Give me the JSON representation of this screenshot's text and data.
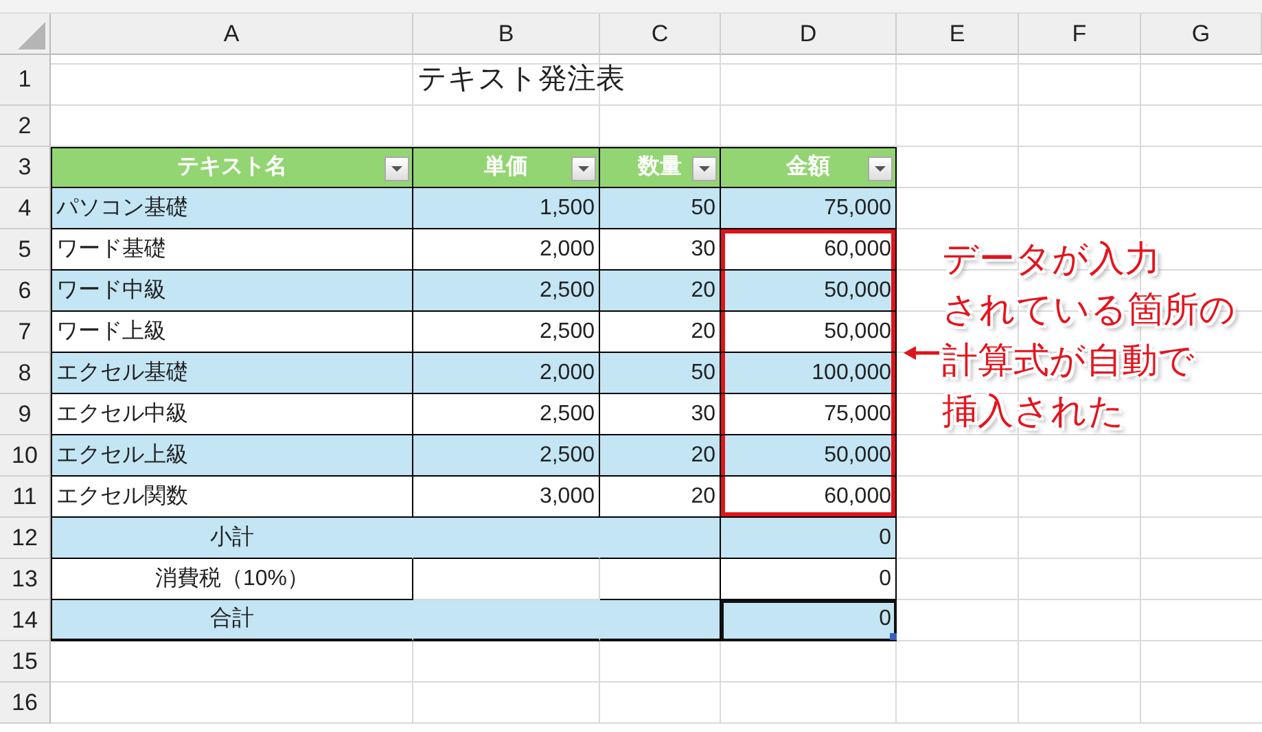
{
  "column_headers": [
    "A",
    "B",
    "C",
    "D",
    "E",
    "F",
    "G"
  ],
  "row_headers": [
    "1",
    "2",
    "3",
    "4",
    "5",
    "6",
    "7",
    "8",
    "9",
    "10",
    "11",
    "12",
    "13",
    "14",
    "15",
    "16"
  ],
  "sheet_title": "テキスト発注表",
  "table": {
    "columns": [
      {
        "label": "テキスト名",
        "filter": true
      },
      {
        "label": "単価",
        "filter": true
      },
      {
        "label": "数量",
        "filter": true
      },
      {
        "label": "金額",
        "filter": true
      }
    ],
    "rows": [
      {
        "name": "パソコン基礎",
        "price": "1,500",
        "qty": "50",
        "amount": "75,000",
        "shaded": true,
        "highlighted": false
      },
      {
        "name": "ワード基礎",
        "price": "2,000",
        "qty": "30",
        "amount": "60,000",
        "shaded": false,
        "highlighted": true
      },
      {
        "name": "ワード中級",
        "price": "2,500",
        "qty": "20",
        "amount": "50,000",
        "shaded": true,
        "highlighted": true
      },
      {
        "name": "ワード上級",
        "price": "2,500",
        "qty": "20",
        "amount": "50,000",
        "shaded": false,
        "highlighted": true
      },
      {
        "name": "エクセル基礎",
        "price": "2,000",
        "qty": "50",
        "amount": "100,000",
        "shaded": true,
        "highlighted": true
      },
      {
        "name": "エクセル中級",
        "price": "2,500",
        "qty": "30",
        "amount": "75,000",
        "shaded": false,
        "highlighted": true
      },
      {
        "name": "エクセル上級",
        "price": "2,500",
        "qty": "20",
        "amount": "50,000",
        "shaded": true,
        "highlighted": true
      },
      {
        "name": "エクセル関数",
        "price": "3,000",
        "qty": "20",
        "amount": "60,000",
        "shaded": false,
        "highlighted": true
      }
    ],
    "summary": [
      {
        "label": "小計",
        "value": "0",
        "shaded": true,
        "selected": false
      },
      {
        "label": "消費税（10%）",
        "value": "0",
        "shaded": false,
        "selected": false
      },
      {
        "label": "合計",
        "value": "0",
        "shaded": true,
        "selected": true
      }
    ]
  },
  "callout": {
    "lines": [
      "データが入力",
      "されている箇所の",
      "計算式が自動で",
      "挿入された"
    ]
  }
}
